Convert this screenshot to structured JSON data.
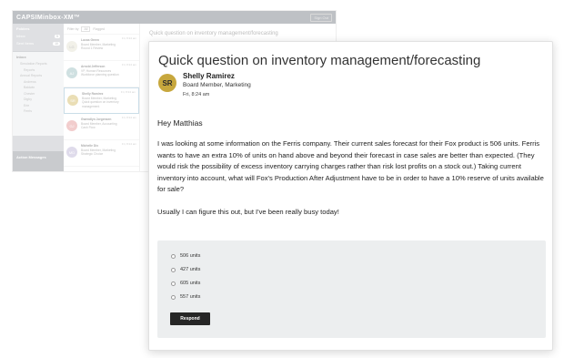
{
  "background_app": {
    "logo": "CAPSIMinbox-XM™",
    "logout": "Sign Out",
    "nav": {
      "folders_title": "Folders",
      "folders": [
        {
          "label": "Inbox",
          "count": "5"
        },
        {
          "label": "Sent Items",
          "count": "10"
        }
      ],
      "inbox_title": "Inbox",
      "tree": [
        "Simulation Reports",
        "Reports",
        "Annual Reports",
        "Andrews",
        "Baldwin",
        "Chester",
        "Digby",
        "Erie",
        "Ferris"
      ],
      "bottom_title": "Action Messages"
    },
    "list": {
      "filter": [
        "Filter by",
        "All",
        "Flagged"
      ],
      "items": [
        {
          "initials": "LG",
          "name": "Lucas Green",
          "lines": [
            "Board Member, Marketing",
            "Round 1 Review"
          ],
          "date": "Fri, 8:24 am",
          "color": "#e8e6d8"
        },
        {
          "initials": "AJ",
          "name": "Arnold Jefferson",
          "lines": [
            "VP, Human Resources",
            "Workforce planning question"
          ],
          "date": "Fri, 8:24 am",
          "color": "#a8c8c9"
        },
        {
          "initials": "SR",
          "name": "Shelly Ramirez",
          "lines": [
            "Board Member, Marketing",
            "Quick question on inventory management"
          ],
          "date": "Fri, 8:24 am",
          "color": "#d9c47a"
        },
        {
          "initials": "GJ",
          "name": "Gwendlyn Jorgensen",
          "lines": [
            "Board Member, Accounting",
            "Cash Flow"
          ],
          "date": "Fri, 8:24 am",
          "color": "#e9a5a5"
        },
        {
          "initials": "MD",
          "name": "Michelle Dix",
          "lines": [
            "Board Member, Marketing",
            "Strategic Choice"
          ],
          "date": "Fri, 8:24 am",
          "color": "#c6bfdc"
        }
      ]
    },
    "reading_title": "Quick question on inventory management/forecasting"
  },
  "message": {
    "subject": "Quick question on inventory management/forecasting",
    "sender": {
      "initials": "SR",
      "name": "Shelly Ramirez",
      "role": "Board Member, Marketing",
      "time": "Fri, 8:24 am"
    },
    "greeting": "Hey Matthias",
    "paragraphs": [
      "I was looking at some information on the Ferris company. Their current sales forecast for their Fox product is 506 units. Ferris wants to have an extra 10% of units on hand above and beyond their forecast in case sales are better than expected. (They would risk the possibility of excess inventory carrying charges rather than risk lost profits on a stock out.) Taking current inventory into account, what will Fox's Production After Adjustment have to be in order to have a 10% reserve of units available for sale?",
      "Usually I can figure this out, but I've been really busy today!"
    ],
    "options": [
      "506 units",
      "427 units",
      "605 units",
      "557 units"
    ],
    "respond_label": "Respond"
  },
  "colors": {
    "avatar": "#c7a73d",
    "respond_button": "#262626",
    "choices_panel": "#eceeef"
  }
}
